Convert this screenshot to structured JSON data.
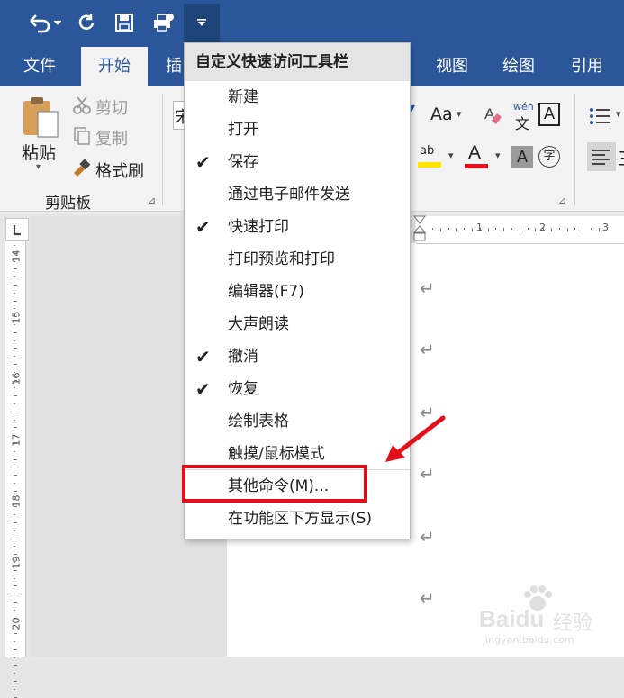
{
  "colors": {
    "ribbon_blue": "#2b579a",
    "accent_red": "#e3101b",
    "highlight_yellow": "#ffe600",
    "font_red": "#e3101b"
  },
  "qat": {
    "icons": [
      "undo-icon",
      "redo-icon",
      "save-icon",
      "quick-print-icon",
      "customize-dropdown-icon"
    ]
  },
  "tabs": {
    "file": "文件",
    "home": "开始",
    "insert_partial": "插",
    "view": "视图",
    "draw": "绘图",
    "references": "引用"
  },
  "ribbon": {
    "paste": "粘贴",
    "cut": "剪切",
    "copy": "复制",
    "format_painter": "格式刷",
    "group_clipboard": "剪贴板",
    "font_partial": "宋",
    "change_case": "Aa",
    "phonetic_top": "wén",
    "phonetic_bottom": "文",
    "boxed_char": "A",
    "font_color_char": "A",
    "shade_char": "A",
    "enclose_char": "字",
    "highlight_char": "ab",
    "para_partial": "三"
  },
  "ruler": {
    "h_ticks": [
      "1",
      "2",
      "3"
    ],
    "v_ticks": [
      "14",
      "15",
      "16",
      "17",
      "18",
      "19",
      "20"
    ]
  },
  "menu": {
    "header": "自定义快速访问工具栏",
    "items": [
      {
        "label": "新建",
        "checked": false
      },
      {
        "label": "打开",
        "checked": false
      },
      {
        "label": "保存",
        "checked": true
      },
      {
        "label": "通过电子邮件发送",
        "checked": false
      },
      {
        "label": "快速打印",
        "checked": true
      },
      {
        "label": "打印预览和打印",
        "checked": false
      },
      {
        "label": "编辑器(F7)",
        "checked": false
      },
      {
        "label": "大声朗读",
        "checked": false
      },
      {
        "label": "撤消",
        "checked": true
      },
      {
        "label": "恢复",
        "checked": true
      },
      {
        "label": "绘制表格",
        "checked": false
      },
      {
        "label": "触摸/鼠标模式",
        "checked": false
      },
      {
        "label": "其他命令(M)...",
        "checked": false
      },
      {
        "label": "在功能区下方显示(S)",
        "checked": false
      }
    ],
    "check_glyph": "✔"
  },
  "doc": {
    "paragraph_mark": "↵"
  },
  "watermark": {
    "brand": "Baidu",
    "brand_cn": "经验",
    "url": "jingyan.baidu.com"
  }
}
